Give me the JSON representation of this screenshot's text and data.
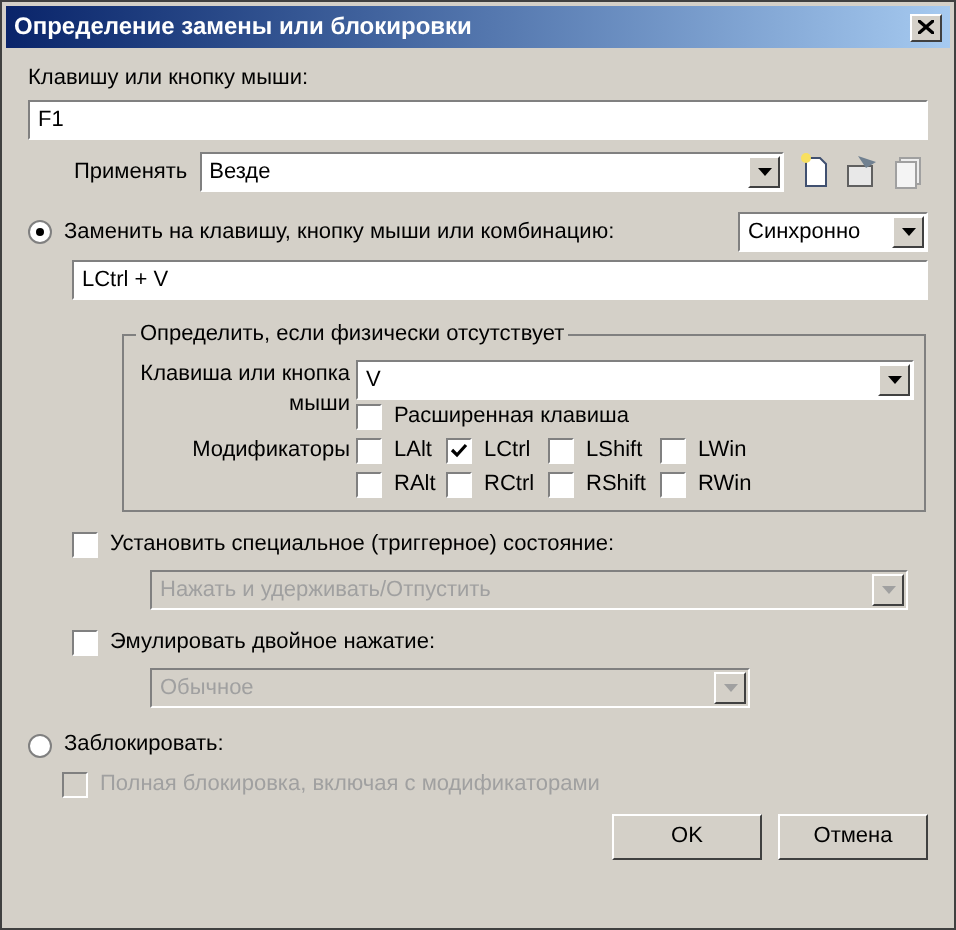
{
  "window": {
    "title": "Определение замены или блокировки"
  },
  "key_label": "Клавишу или кнопку мыши:",
  "key_field": {
    "value": "F1"
  },
  "apply": {
    "label": "Применять",
    "value": "Везде"
  },
  "replace": {
    "label": "Заменить на клавишу, кнопку мыши или комбинацию:",
    "selected": true,
    "mode": "Синхронно",
    "value": "LCtrl + V"
  },
  "group": {
    "title": "Определить, если физически отсутствует",
    "key_label": "Клавиша или кнопка мыши",
    "key_value": "V",
    "extended": {
      "label": "Расширенная клавиша",
      "checked": false
    },
    "modifiers_label": "Модификаторы",
    "modifiers": [
      {
        "label": "LAlt",
        "checked": false
      },
      {
        "label": "LCtrl",
        "checked": true
      },
      {
        "label": "LShift",
        "checked": false
      },
      {
        "label": "LWin",
        "checked": false
      },
      {
        "label": "RAlt",
        "checked": false
      },
      {
        "label": "RCtrl",
        "checked": false
      },
      {
        "label": "RShift",
        "checked": false
      },
      {
        "label": "RWin",
        "checked": false
      }
    ]
  },
  "trigger": {
    "label": "Установить специальное (триггерное) состояние:",
    "checked": false,
    "value": "Нажать и удерживать/Отпустить",
    "disabled": true
  },
  "double_press": {
    "label": "Эмулировать двойное нажатие:",
    "checked": false,
    "value": "Обычное",
    "disabled": true
  },
  "block": {
    "label": "Заблокировать:",
    "selected": false
  },
  "full_block": {
    "label": "Полная блокировка, включая с модификаторами",
    "checked": false,
    "disabled": true
  },
  "buttons": [
    "OK",
    "Отмена"
  ]
}
